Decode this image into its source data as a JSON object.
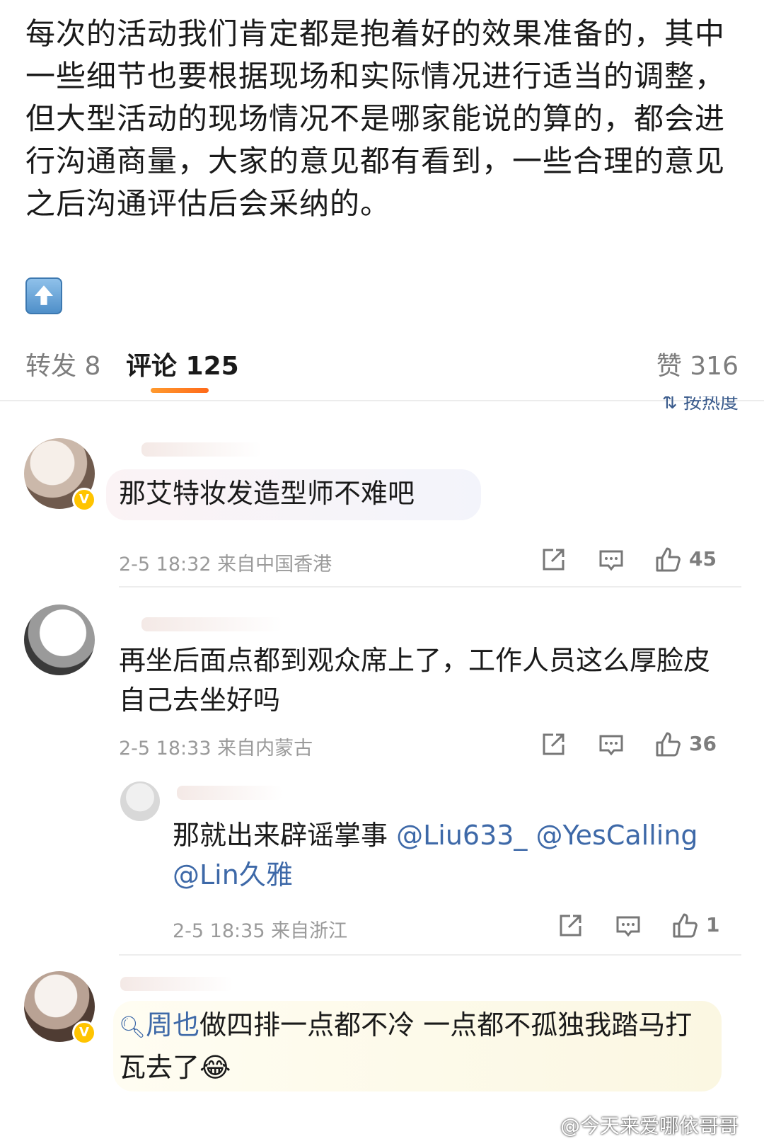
{
  "post": {
    "text": "每次的活动我们肯定都是抱着好的效果准备的，其中一些细节也要根据现场和实际情况进行适当的调整，但大型活动的现场情况不是哪家能说的算的，都会进行沟通商量，大家的意见都有看到，一些合理的意见之后沟通评估后会采纳的。",
    "emoji_icon": "up-arrow-icon"
  },
  "tabs": {
    "repost": "转发 8",
    "comments": "评论 125",
    "likes": "赞 316",
    "sort": "按热度",
    "accent": "#ff8a24"
  },
  "comments": [
    {
      "body": "那艾特妆发造型师不难吧",
      "time": "2-5 18:32",
      "location": "来自中国香港",
      "likes": "45",
      "verified": true
    },
    {
      "body": "再坐后面点都到观众席上了，工作人员这么厚脸皮自己去坐好吗",
      "time": "2-5 18:33",
      "location": "来自内蒙古",
      "likes": "36",
      "verified": false
    },
    {
      "reply": true,
      "body_prefix": "那就出来辟谣掌事 ",
      "mention_1": "@Liu633_",
      "mention_2": " @YesCalling",
      "mention_3": "@Lin久雅",
      "time": "2-5 18:35",
      "location": "来自浙江",
      "likes": "1"
    },
    {
      "search_topic": "周也",
      "body_rest": "做四排一点都不冷 一点都不孤独我踏马打瓦去了",
      "emoji": "😂",
      "verified": true
    }
  ],
  "watermark": "@今天来爱哪依哥哥",
  "mention_color": "#3e69a8"
}
